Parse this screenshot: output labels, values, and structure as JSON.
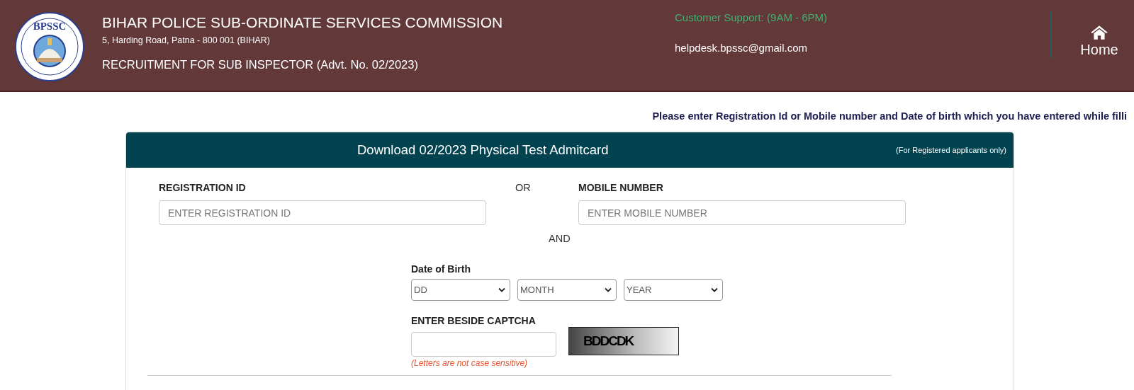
{
  "header": {
    "logo_text": "BPSSC",
    "title": "BIHAR POLICE SUB-ORDINATE SERVICES COMMISSION",
    "address": "5, Harding Road, Patna - 800 001 (BIHAR)",
    "subtitle": "RECRUITMENT FOR SUB INSPECTOR (Advt. No. 02/2023)",
    "support": "Customer Support: (9AM - 6PM)",
    "email": "helpdesk.bpssc@gmail.com",
    "home": "Home"
  },
  "notice": "Please enter Registration Id or Mobile number and Date of birth which you have entered while filli",
  "card": {
    "title": "Download 02/2023 Physical Test Admitcard",
    "note": "(For Registered applicants only)",
    "registration": {
      "label": "REGISTRATION ID",
      "placeholder": "ENTER REGISTRATION ID"
    },
    "or": "OR",
    "mobile": {
      "label": "MOBILE NUMBER",
      "placeholder": "ENTER MOBILE NUMBER"
    },
    "and": "AND",
    "dob": {
      "label": "Date of Birth",
      "selects": [
        {
          "value": "DD"
        },
        {
          "value": "MONTH"
        },
        {
          "value": "YEAR"
        }
      ]
    },
    "captcha": {
      "label": "ENTER BESIDE CAPTCHA",
      "code": "BDDCDK",
      "hint": "(Letters are not case sensitive)"
    }
  }
}
